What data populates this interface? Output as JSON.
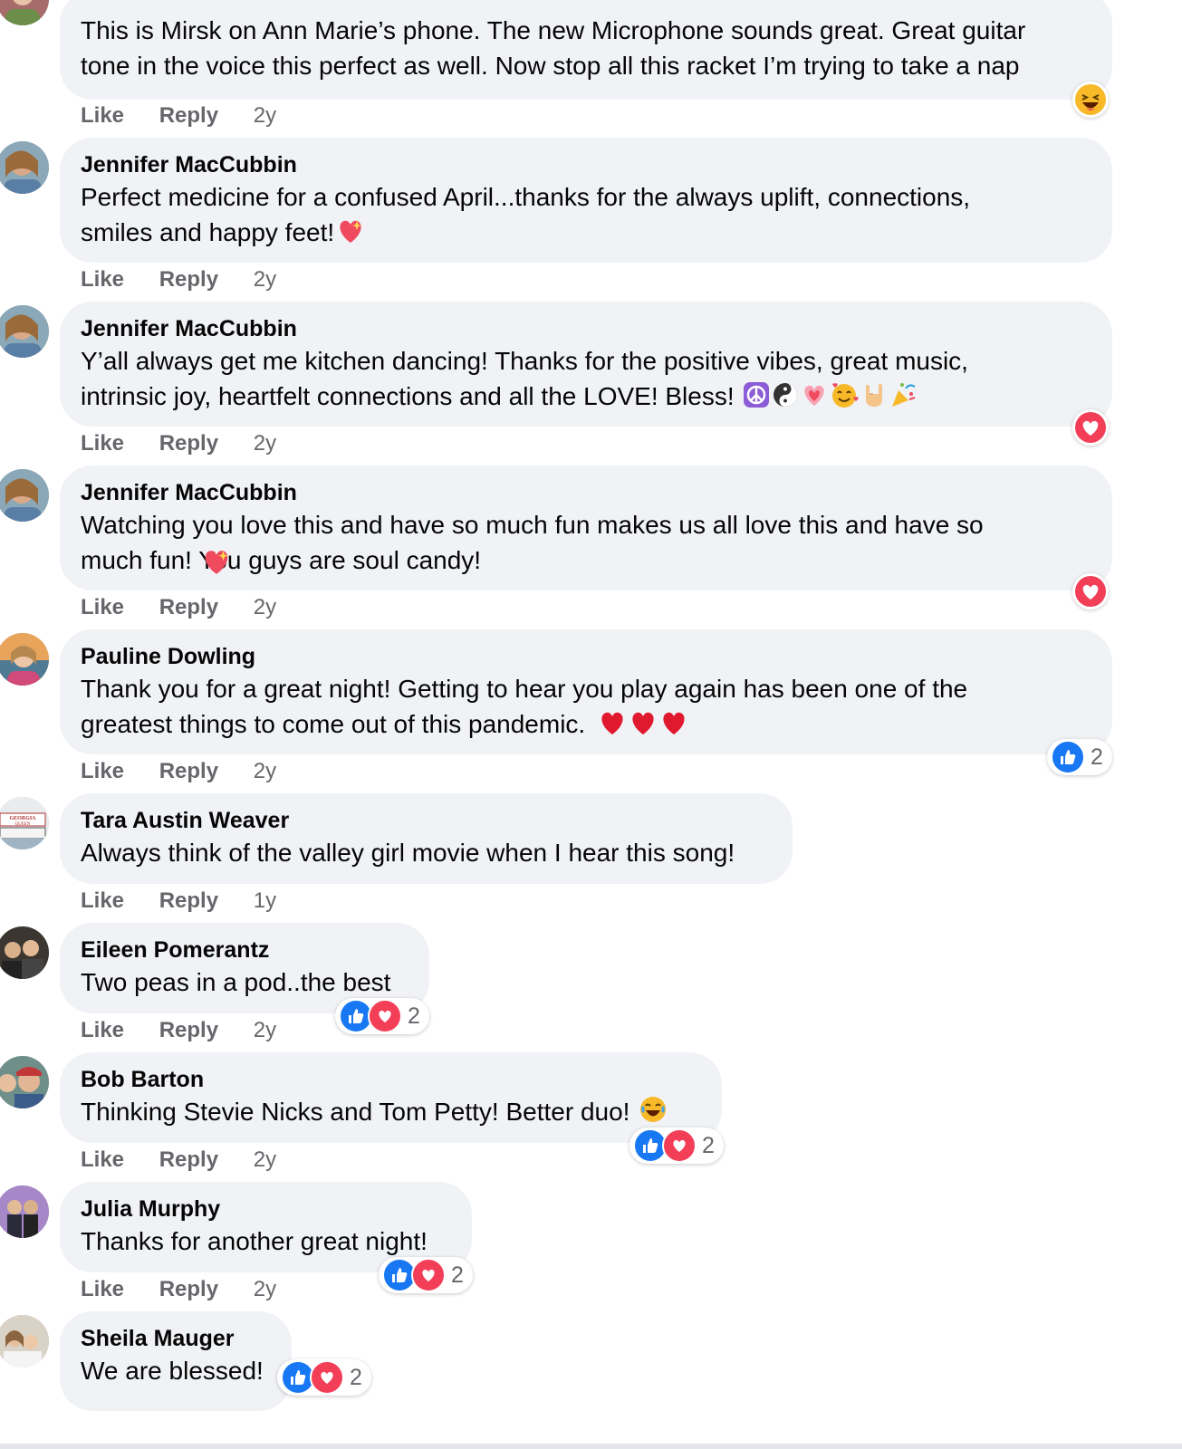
{
  "actions": {
    "like": "Like",
    "reply": "Reply"
  },
  "top_comment": {
    "lines": [
      "This is Mirsk on Ann Marie’s phone. The new Microphone sounds great. Great guitar",
      "tone in the voice this perfect as well. Now stop all this racket I’m trying to take a nap"
    ],
    "time": "2y",
    "reaction": "haha-icon"
  },
  "comments": [
    {
      "author": "Jennifer MacCubbin",
      "lines": [
        "Perfect medicine for a confused April...thanks for the always uplift, connections,",
        "smiles and happy feet!"
      ],
      "trailing_emoji": [
        "sparkling-heart-emoji"
      ],
      "time": "2y",
      "reaction": null
    },
    {
      "author": "Jennifer MacCubbin",
      "lines": [
        "Y’all always get me kitchen dancing! Thanks for the positive vibes, great music,",
        "intrinsic joy, heartfelt connections and all the LOVE! Bless!"
      ],
      "trailing_emoji": [
        "peace-emoji",
        "yin-yang-emoji",
        "pink-heart-emoji",
        "smiling-hearts-emoji",
        "love-you-hand-emoji",
        "party-popper-emoji"
      ],
      "time": "2y",
      "reaction": "love-icon"
    },
    {
      "author": "Jennifer MacCubbin",
      "lines": [
        "Watching you love this and have so much fun makes us all love this and have so",
        "much fun!  You guys are soul candy!"
      ],
      "trailing_emoji": [],
      "time": "2y",
      "reaction": "love-icon"
    },
    {
      "author": "Pauline Dowling",
      "lines": [
        "Thank you for a great night! Getting to hear you play again has been one of the",
        "greatest things to come out of this pandemic."
      ],
      "trailing_emoji": [
        "red-heart-emoji",
        "red-heart-emoji",
        "red-heart-emoji"
      ],
      "time": "2y",
      "reaction": "like-icon",
      "reaction_count": "2"
    },
    {
      "author": "Tara Austin Weaver",
      "lines": [
        "Always think of the valley girl movie when I hear this song!"
      ],
      "trailing_emoji": [],
      "time": "1y",
      "reaction": null
    },
    {
      "author": "Eileen Pomerantz",
      "lines": [
        "Two peas in a pod..the best"
      ],
      "trailing_emoji": [],
      "time": "2y",
      "reaction": "like-love-icons",
      "reaction_count": "2"
    },
    {
      "author": "Bob Barton",
      "lines": [
        "Thinking Stevie Nicks and Tom Petty! Better duo!"
      ],
      "trailing_emoji": [
        "laughing-tears-emoji"
      ],
      "time": "2y",
      "reaction": "like-love-icons",
      "reaction_count": "2"
    },
    {
      "author": "Julia Murphy",
      "lines": [
        "Thanks for another great night!"
      ],
      "trailing_emoji": [],
      "time": "2y",
      "reaction": "like-love-icons",
      "reaction_count": "2"
    },
    {
      "author": "Sheila Mauger",
      "lines": [
        "We are blessed!"
      ],
      "trailing_emoji": [],
      "time": "",
      "reaction": "like-love-icons",
      "reaction_count": "2"
    }
  ],
  "colors": {
    "bubble": "#f0f2f5",
    "secondary_text": "#65676b",
    "like_blue": "#1877f2",
    "love_red": "#f33e58"
  }
}
